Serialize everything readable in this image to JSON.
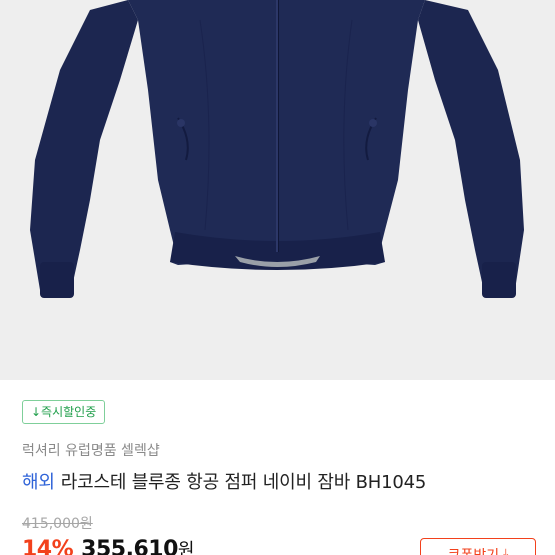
{
  "product": {
    "image_alt": "navy zip-up bomber jacket",
    "delivery_tag": "↓즉시할인중",
    "seller": "럭셔리 유럽명품 셀렉샵",
    "overseas_label": "해외",
    "title": "라코스테 블루종 항공 점퍼 네이비 잠바 BH1045",
    "original_price": "415,000원",
    "discount": "14%",
    "sale_price": "355,610",
    "currency": "원"
  },
  "coupon": {
    "label": "쿠폰받기",
    "icon": "download-icon"
  },
  "colors": {
    "accent_red": "#f2411c",
    "tag_green": "#1f9e4a",
    "overseas_blue": "#2f63d8",
    "jacket_navy": "#1f2a55"
  }
}
